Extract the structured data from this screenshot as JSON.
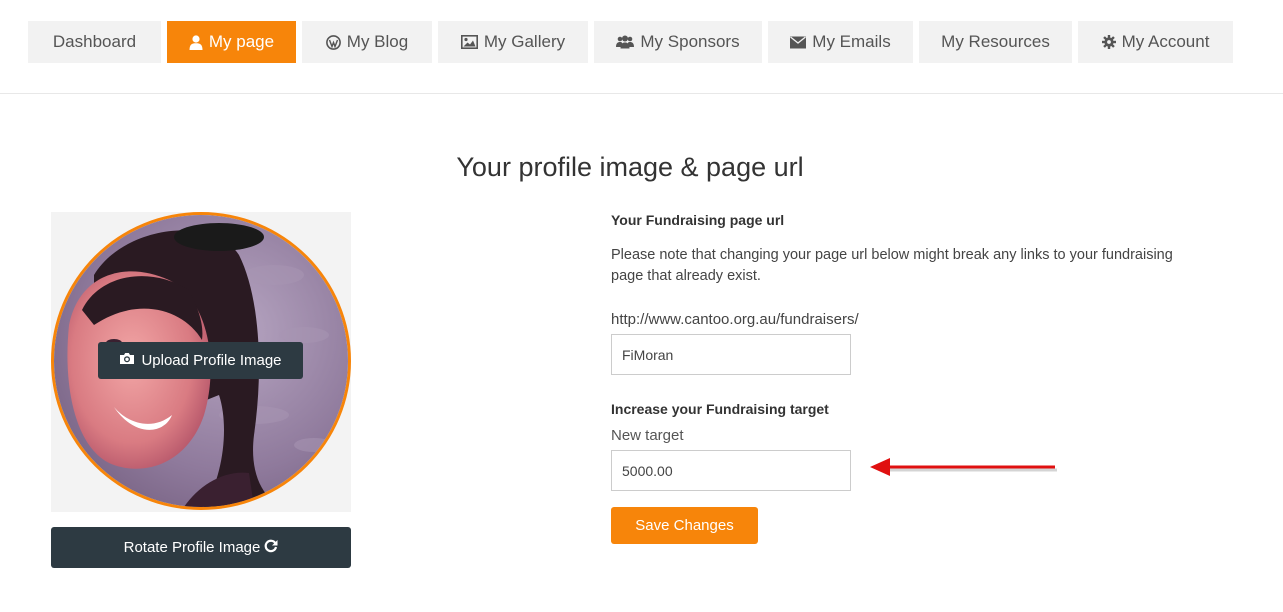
{
  "nav": {
    "tabs": [
      {
        "label": "Dashboard",
        "icon": "",
        "active": false
      },
      {
        "label": "My page",
        "icon": "user-icon",
        "active": true
      },
      {
        "label": "My Blog",
        "icon": "wordpress-icon",
        "active": false
      },
      {
        "label": "My Gallery",
        "icon": "image-icon",
        "active": false
      },
      {
        "label": "My Sponsors",
        "icon": "users-icon",
        "active": false
      },
      {
        "label": "My Emails",
        "icon": "envelope-icon",
        "active": false
      },
      {
        "label": "My Resources",
        "icon": "",
        "active": false
      },
      {
        "label": "My Account",
        "icon": "gear-icon",
        "active": false
      }
    ]
  },
  "section": {
    "title": "Your profile image & page url"
  },
  "profile": {
    "upload_label": "Upload Profile Image",
    "rotate_label": "Rotate Profile Image"
  },
  "form": {
    "url_heading": "Your Fundraising page url",
    "url_note": "Please note that changing your page url below might break any links to your fundraising page that already exist.",
    "url_prefix": "http://www.cantoo.org.au/fundraisers/",
    "url_value": "FiMoran",
    "target_heading": "Increase your Fundraising target",
    "target_label": "New target",
    "target_value": "5000.00",
    "save_label": "Save Changes"
  },
  "colors": {
    "accent": "#f7850a",
    "dark_button": "#2d3a42",
    "arrow": "#e01010"
  }
}
